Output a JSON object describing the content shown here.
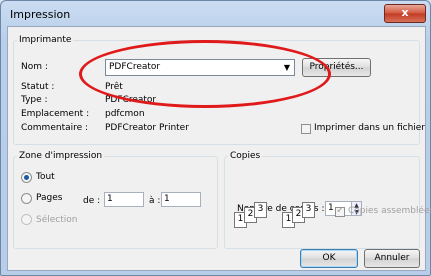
{
  "window": {
    "title": "Impression",
    "close_glyph": "x"
  },
  "printer": {
    "legend": "Imprimante",
    "name_label": "Nom :",
    "name_value": "PDFCreator",
    "properties_label": "Propriétés...",
    "status_label": "Statut :",
    "status_value": "Prêt",
    "type_label": "Type :",
    "type_value": "PDFCreator",
    "location_label": "Emplacement :",
    "location_value": "pdfcmon",
    "comment_label": "Commentaire :",
    "comment_value": "PDFCreator Printer",
    "print_to_file_label": "Imprimer dans un fichier",
    "print_to_file_checked": false
  },
  "range": {
    "legend": "Zone d'impression",
    "all_label": "Tout",
    "pages_label": "Pages",
    "from_label": "de :",
    "from_value": "1",
    "to_label": "à :",
    "to_value": "1",
    "selection_label": "Sélection",
    "selected": "all"
  },
  "copies": {
    "legend": "Copies",
    "count_label": "Nombre de copies :",
    "count_value": "1",
    "collate_label": "Copies assemblées",
    "collate_checked": true,
    "collate_pages": [
      "1",
      "2",
      "3"
    ]
  },
  "footer": {
    "ok_label": "OK",
    "cancel_label": "Annuler"
  },
  "annotation": {
    "color": "#e01a1a"
  }
}
